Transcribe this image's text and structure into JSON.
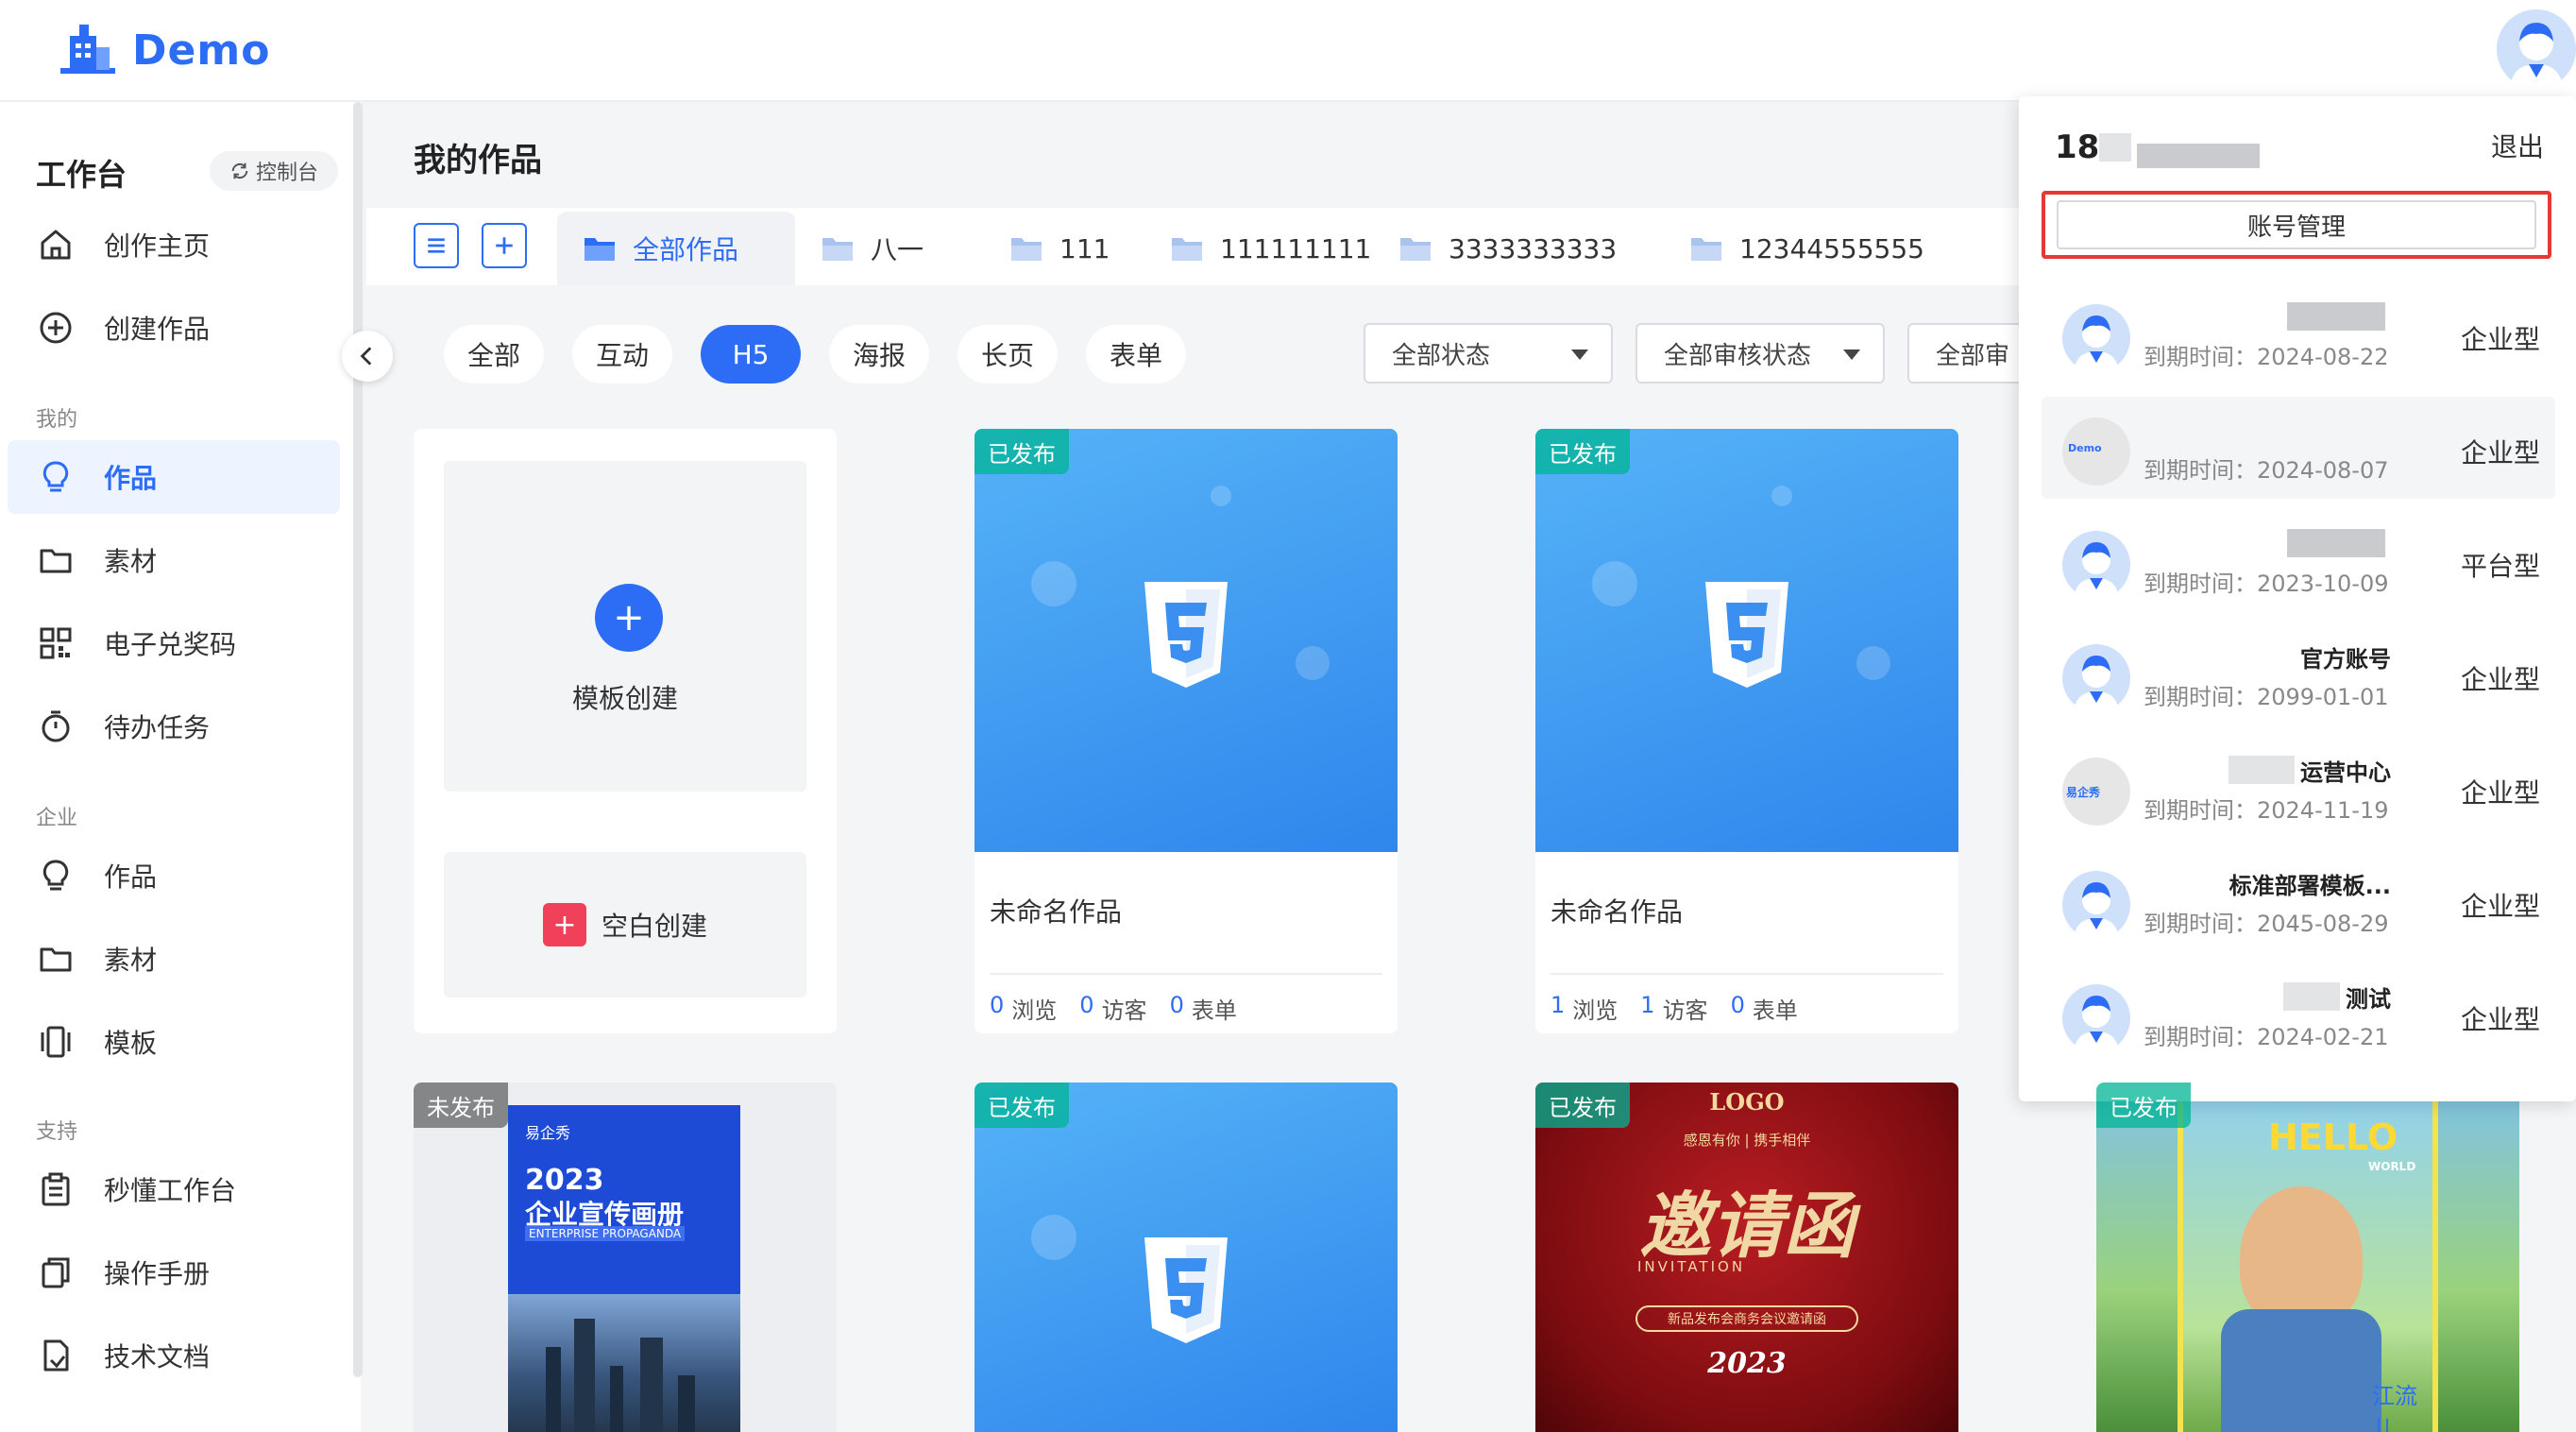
{
  "brand": {
    "name": "Demo",
    "accent": "#2d6df6"
  },
  "sidebar": {
    "workspace_title": "工作台",
    "control_label": "控制台",
    "items_top": [
      {
        "label": "创作主页",
        "icon": "home-icon"
      },
      {
        "label": "创建作品",
        "icon": "plus-circle-icon"
      }
    ],
    "sections": [
      {
        "label": "我的",
        "items": [
          {
            "label": "作品",
            "icon": "bulb-icon",
            "active": true
          },
          {
            "label": "素材",
            "icon": "folder-icon"
          },
          {
            "label": "电子兑奖码",
            "icon": "qrcode-icon"
          },
          {
            "label": "待办任务",
            "icon": "timer-icon"
          }
        ]
      },
      {
        "label": "企业",
        "items": [
          {
            "label": "作品",
            "icon": "bulb-icon"
          },
          {
            "label": "素材",
            "icon": "folder-icon"
          },
          {
            "label": "模板",
            "icon": "template-icon"
          }
        ]
      },
      {
        "label": "支持",
        "items": [
          {
            "label": "秒懂工作台",
            "icon": "clipboard-icon"
          },
          {
            "label": "操作手册",
            "icon": "manual-icon"
          },
          {
            "label": "技术文档",
            "icon": "doc-icon"
          }
        ]
      }
    ]
  },
  "main": {
    "title": "我的作品",
    "folders": [
      "全部作品",
      "八一",
      "111",
      "111111111",
      "3333333333",
      "12344555555"
    ],
    "filters": [
      "全部",
      "互动",
      "H5",
      "海报",
      "长页",
      "表单"
    ],
    "active_filter": "H5",
    "selects": [
      "全部状态",
      "全部审核状态",
      "全部审"
    ],
    "create": {
      "template_label": "模板创建",
      "blank_label": "空白创建"
    },
    "works": [
      {
        "status": "已发布",
        "name": "未命名作品",
        "views": "0",
        "views_label": "浏览",
        "visitors": "0",
        "visitors_label": "访客",
        "forms": "0",
        "forms_label": "表单"
      },
      {
        "status": "已发布",
        "name": "未命名作品",
        "views": "1",
        "views_label": "浏览",
        "visitors": "1",
        "visitors_label": "访客",
        "forms": "0",
        "forms_label": "表单"
      }
    ],
    "posters": [
      {
        "status": "未发布",
        "brand": "易企秀",
        "year": "2023",
        "title": "企业宣传画册",
        "subtitle": "ENTERPRISE PROPAGANDA"
      },
      {
        "status": "已发布"
      },
      {
        "status": "已发布",
        "logo": "LOGO",
        "tagline": "感恩有你 | 携手相伴",
        "script": "邀请函",
        "invitation": "INVITATION",
        "event": "新品发布会商务会议邀请函",
        "year": "2023"
      },
      {
        "status": "已发布",
        "hello": "HELLO",
        "world": "WORLD",
        "name": "江流儿"
      }
    ]
  },
  "dropdown": {
    "phone_prefix": "18",
    "logout": "退出",
    "manage": "账号管理",
    "expire_label": "到期时间：",
    "accounts": [
      {
        "name": "",
        "date": "2024-08-22",
        "type": "企业型",
        "avatar": "user"
      },
      {
        "name": "",
        "date": "2024-08-07",
        "type": "企业型",
        "avatar": "demo",
        "avatar_text": "Demo",
        "selected": true
      },
      {
        "name": "",
        "date": "2023-10-09",
        "type": "平台型",
        "avatar": "user"
      },
      {
        "name": "官方账号",
        "date": "2099-01-01",
        "type": "企业型",
        "avatar": "user"
      },
      {
        "name": "运营中心",
        "date": "2024-11-19",
        "type": "企业型",
        "avatar": "eqx",
        "avatar_text": "易企秀"
      },
      {
        "name": "标准部署模板...",
        "date": "2045-08-29",
        "type": "企业型",
        "avatar": "user"
      },
      {
        "name": "测试",
        "date": "2024-02-21",
        "type": "企业型",
        "avatar": "user"
      }
    ]
  }
}
